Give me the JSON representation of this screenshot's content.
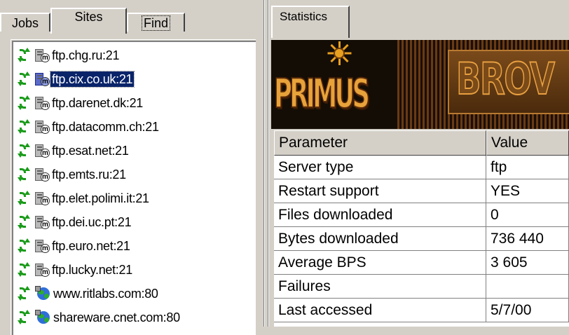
{
  "left_tabs": [
    "Jobs",
    "Sites",
    "Find"
  ],
  "sites": [
    {
      "label": "ftp.chg.ru:21",
      "icon": "server-icon",
      "selected": false
    },
    {
      "label": "ftp.cix.co.uk:21",
      "icon": "server-icon",
      "selected": true
    },
    {
      "label": "ftp.darenet.dk:21",
      "icon": "server-icon",
      "selected": false
    },
    {
      "label": "ftp.datacomm.ch:21",
      "icon": "server-icon",
      "selected": false
    },
    {
      "label": "ftp.esat.net:21",
      "icon": "server-icon",
      "selected": false
    },
    {
      "label": "ftp.emts.ru:21",
      "icon": "server-icon",
      "selected": false
    },
    {
      "label": "ftp.elet.polimi.it:21",
      "icon": "server-icon",
      "selected": false
    },
    {
      "label": "ftp.dei.uc.pt:21",
      "icon": "server-icon",
      "selected": false
    },
    {
      "label": "ftp.euro.net:21",
      "icon": "server-icon",
      "selected": false
    },
    {
      "label": "ftp.lucky.net:21",
      "icon": "server-icon",
      "selected": false
    },
    {
      "label": "www.ritlabs.com:80",
      "icon": "globe-icon",
      "selected": false
    },
    {
      "label": "shareware.cnet.com:80",
      "icon": "globe-icon",
      "selected": false
    }
  ],
  "right_tab": "Statistics",
  "banner": {
    "left_text": "PRIMUS",
    "right_text": "BROV"
  },
  "stats": {
    "headers": [
      "Parameter",
      "Value"
    ],
    "rows": [
      [
        "Server type",
        "ftp"
      ],
      [
        "Restart support",
        "YES"
      ],
      [
        "Files downloaded",
        "0"
      ],
      [
        "Bytes downloaded",
        "736 440"
      ],
      [
        "Average BPS",
        "3 605"
      ],
      [
        "Failures",
        ""
      ],
      [
        "Last accessed",
        "5/7/00"
      ]
    ]
  },
  "colors": {
    "selection": "#0a246a",
    "face": "#d4d0c8",
    "sync": "#1a9b1a"
  }
}
